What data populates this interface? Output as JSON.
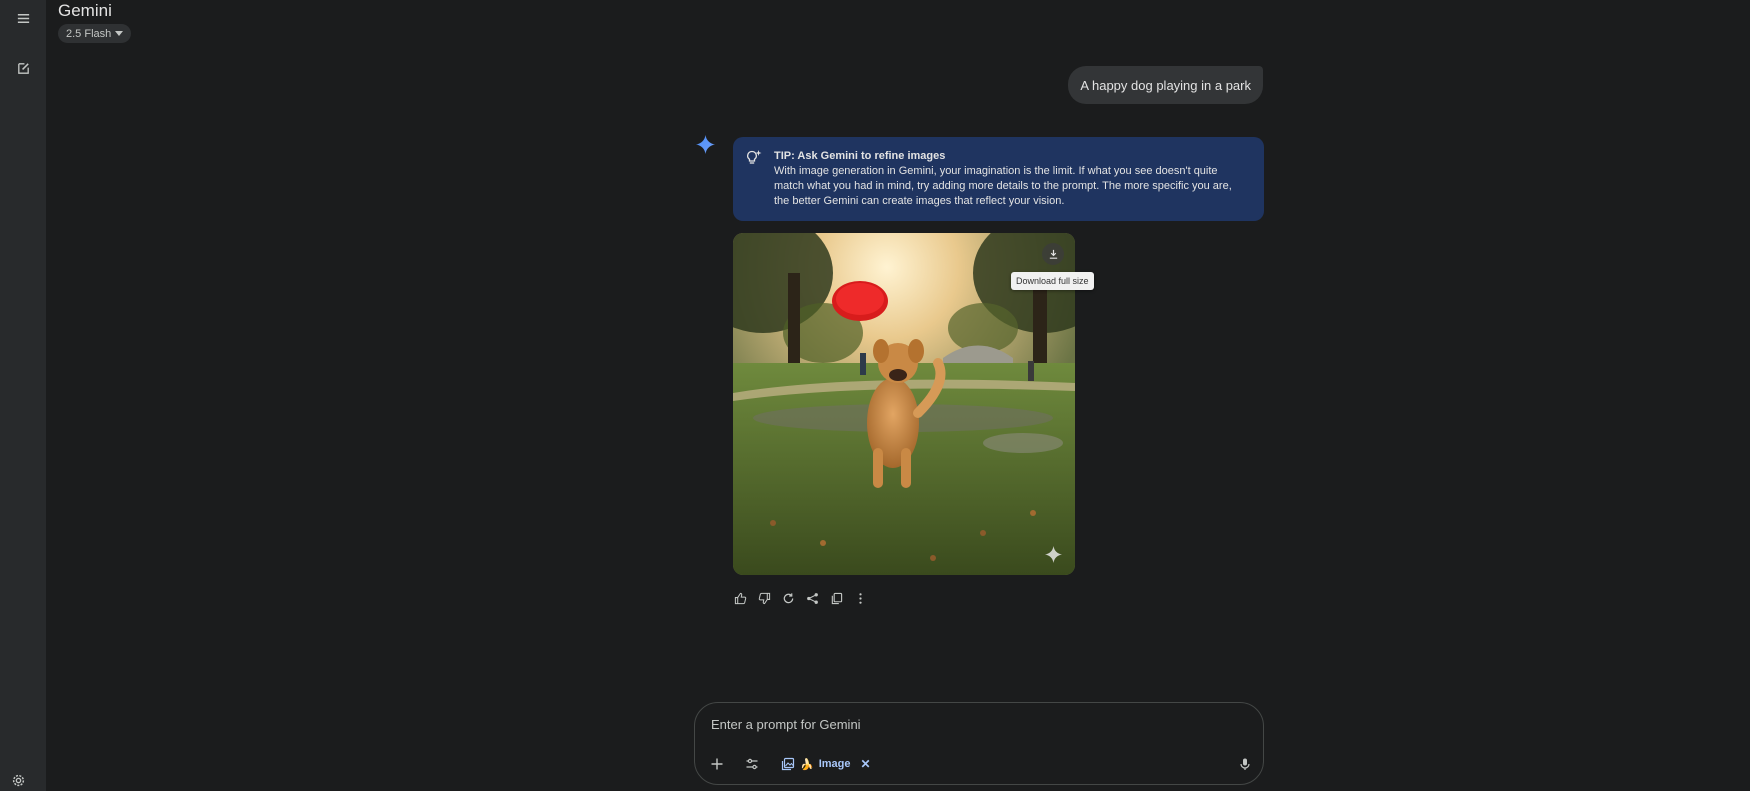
{
  "app": {
    "title": "Gemini",
    "model": "2.5 Flash"
  },
  "user_message": "A happy dog playing in a park",
  "tip": {
    "title": "TIP: Ask Gemini to refine images",
    "body": "With image generation in Gemini, your imagination is the limit. If what you see doesn't quite match what you had in mind, try adding more details to the prompt. The more specific you are, the better Gemini can create images that reflect your vision."
  },
  "image": {
    "tooltip": "Download full size"
  },
  "input": {
    "placeholder": "Enter a prompt for Gemini",
    "tool_chip_label": "Image",
    "tool_chip_emoji": "🍌"
  },
  "colors": {
    "background": "#1b1c1d",
    "rail": "#282a2c",
    "tip_background": "#1f3460",
    "accent_blue": "#a8c7fa"
  },
  "icons": {
    "menu": "menu-icon",
    "new_chat": "edit-icon",
    "settings": "gear-icon",
    "tip": "lightbulb-sparkle-icon",
    "download": "download-icon",
    "thumbs_up": "thumbs-up-icon",
    "thumbs_down": "thumbs-down-icon",
    "regenerate": "refresh-icon",
    "share": "share-icon",
    "copy": "copy-icon",
    "more": "more-vert-icon",
    "add": "plus-icon",
    "tools": "tune-icon",
    "image_tool": "image-stack-icon",
    "mic": "mic-icon"
  }
}
